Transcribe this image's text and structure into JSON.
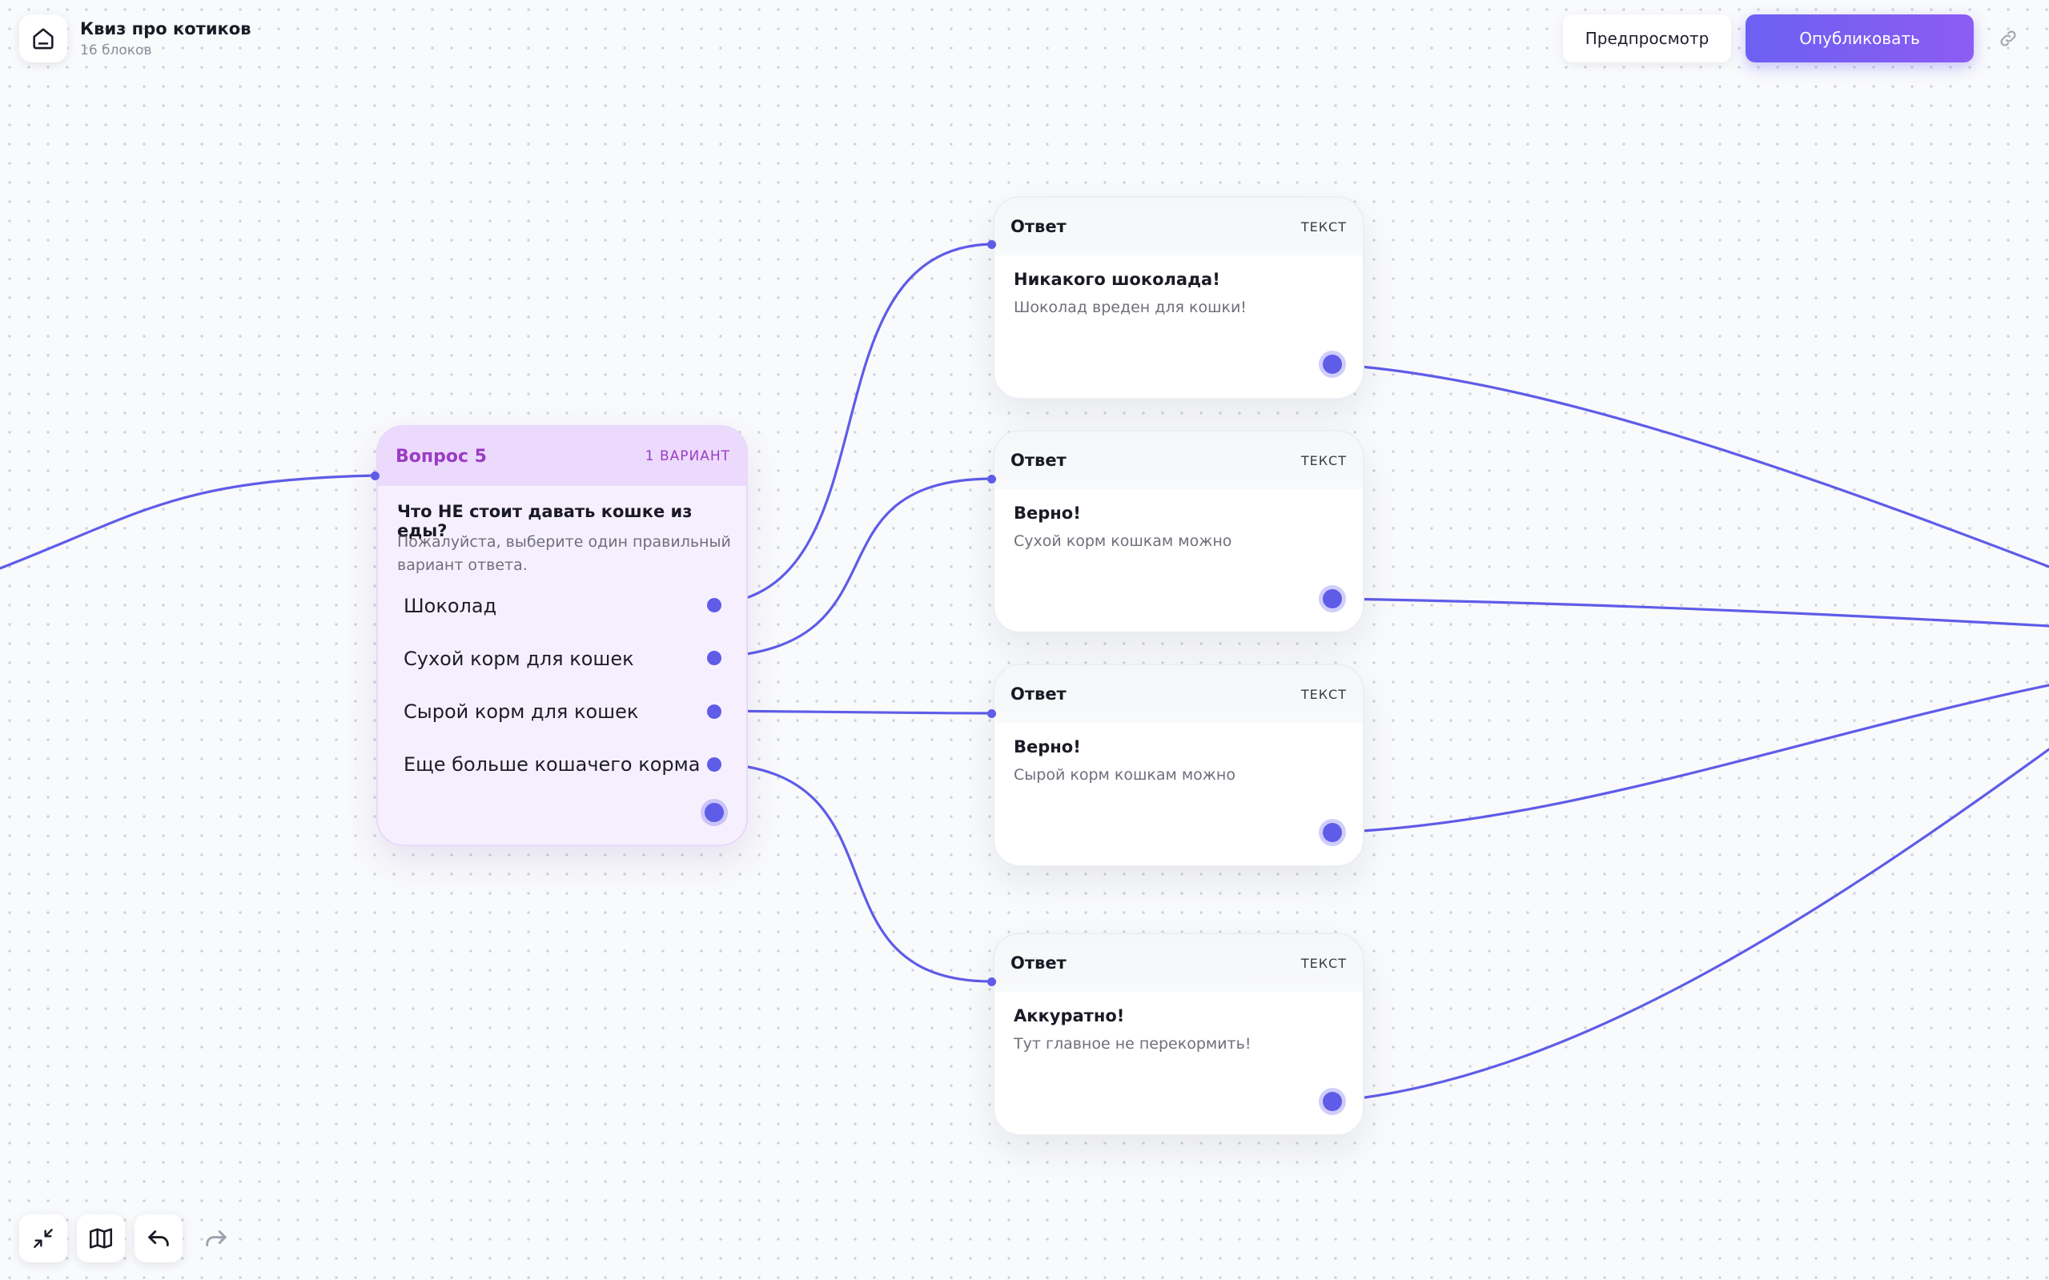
{
  "header": {
    "project_title": "Квиз про котиков",
    "project_subtitle": "16 блоков",
    "preview_label": "Предпросмотр",
    "publish_label": "Опубликовать",
    "icons": {
      "home": "home-icon",
      "link": "link-icon"
    }
  },
  "question_node": {
    "title": "Вопрос 5",
    "badge": "1 ВАРИАНТ",
    "question": "Что НЕ стоит давать кошке из еды?",
    "hint": "Пожалуйста, выберите один правильный вариант ответа.",
    "options": [
      "Шоколад",
      "Сухой корм для кошек",
      "Сырой корм для кошек",
      "Еще больше кошачего корма"
    ]
  },
  "answer_nodes": [
    {
      "title": "Ответ",
      "badge": "ТЕКСТ",
      "heading": "Никакого шоколада!",
      "text": "Шоколад вреден для кошки!"
    },
    {
      "title": "Ответ",
      "badge": "ТЕКСТ",
      "heading": "Верно!",
      "text": "Сухой корм кошкам можно"
    },
    {
      "title": "Ответ",
      "badge": "ТЕКСТ",
      "heading": "Верно!",
      "text": "Сырой корм кошкам можно"
    },
    {
      "title": "Ответ",
      "badge": "ТЕКСТ",
      "heading": "Аккуратно!",
      "text": "Тут главное не перекормить!"
    }
  ],
  "toolbar": {
    "icons": [
      "collapse-icon",
      "map-icon",
      "undo-icon",
      "redo-icon"
    ]
  },
  "colors": {
    "accent": "#5f5ce8",
    "publish_start": "#6c60f2",
    "publish_end": "#8d5cf3",
    "question_header": "#ecdafc",
    "question_title": "#9a3cc4"
  }
}
